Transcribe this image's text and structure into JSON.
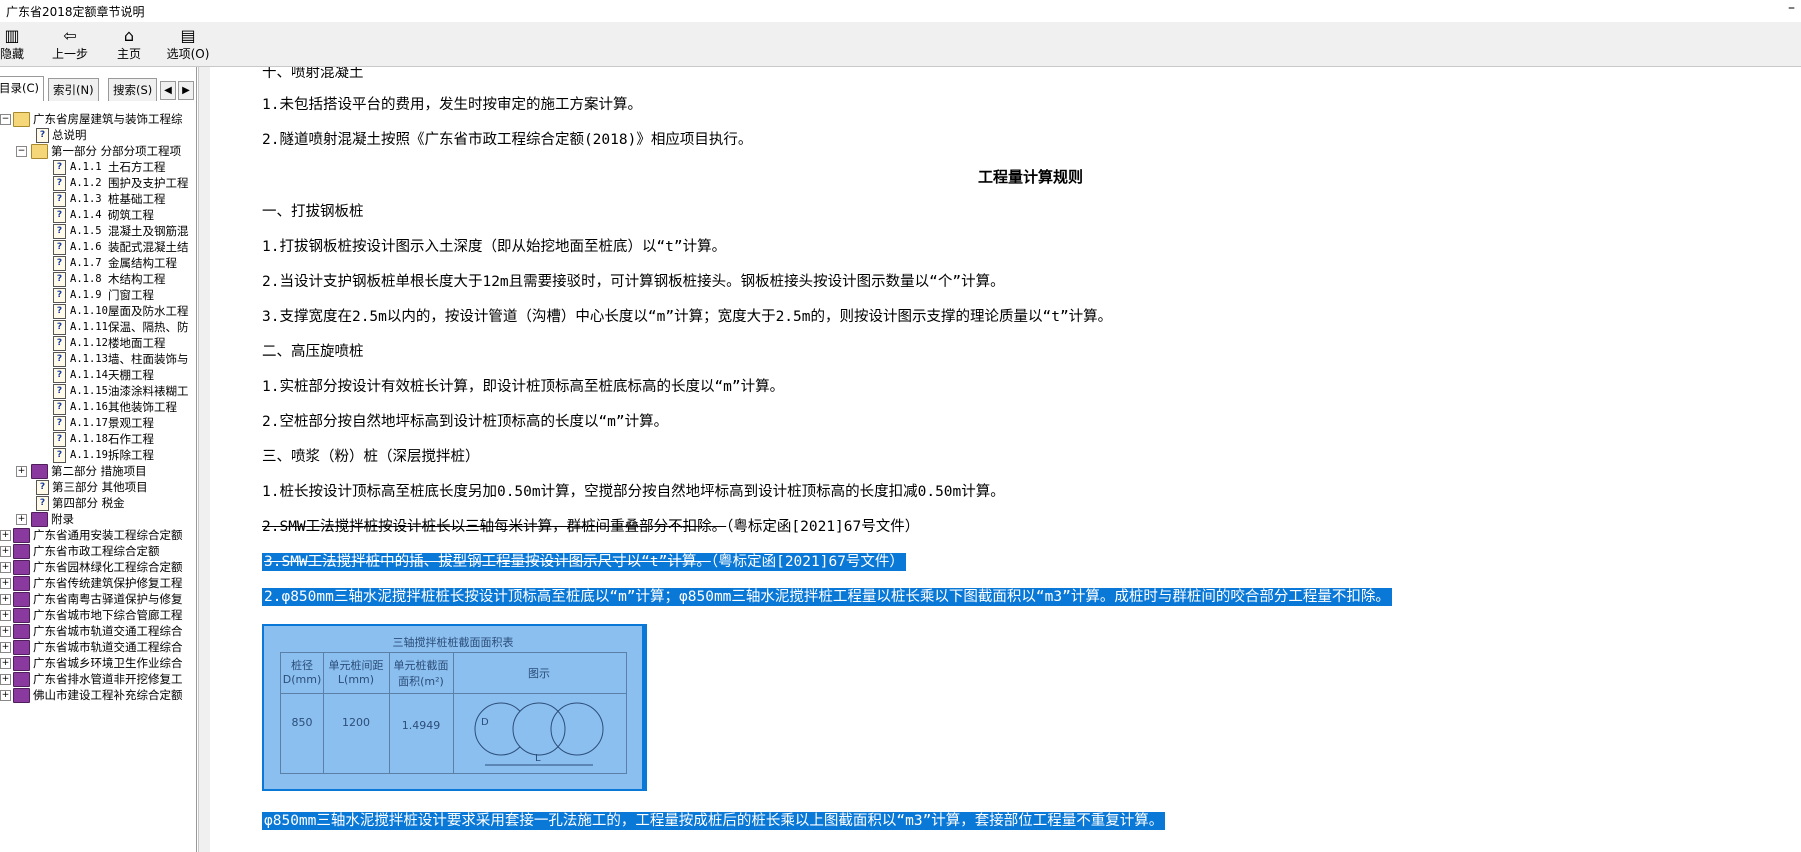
{
  "window": {
    "title": "广东省2018定额章节说明"
  },
  "toolbar": {
    "hide": "隐藏",
    "back": "上一步",
    "home": "主页",
    "options": "选项(O)"
  },
  "tabs": {
    "contents": "目录(C)",
    "index": "索引(N)",
    "search": "搜索(S)"
  },
  "tree": {
    "root": "广东省房屋建筑与装饰工程综",
    "general": "总说明",
    "part1": "第一部分 分部分项工程项",
    "chapters": [
      {
        "code": "A.1.1",
        "name": "土石方工程"
      },
      {
        "code": "A.1.2",
        "name": "围护及支护工程"
      },
      {
        "code": "A.1.3",
        "name": "桩基础工程"
      },
      {
        "code": "A.1.4",
        "name": "砌筑工程"
      },
      {
        "code": "A.1.5",
        "name": "混凝土及钢筋混"
      },
      {
        "code": "A.1.6",
        "name": "装配式混凝土结"
      },
      {
        "code": "A.1.7",
        "name": "金属结构工程"
      },
      {
        "code": "A.1.8",
        "name": "木结构工程"
      },
      {
        "code": "A.1.9",
        "name": "门窗工程"
      },
      {
        "code": "A.1.10",
        "name": "屋面及防水工程"
      },
      {
        "code": "A.1.11",
        "name": "保温、隔热、防"
      },
      {
        "code": "A.1.12",
        "name": "楼地面工程"
      },
      {
        "code": "A.1.13",
        "name": "墙、柱面装饰与"
      },
      {
        "code": "A.1.14",
        "name": "天棚工程"
      },
      {
        "code": "A.1.15",
        "name": "油漆涂料裱糊工"
      },
      {
        "code": "A.1.16",
        "name": "其他装饰工程"
      },
      {
        "code": "A.1.17",
        "name": "景观工程"
      },
      {
        "code": "A.1.18",
        "name": "石作工程"
      },
      {
        "code": "A.1.19",
        "name": "拆除工程"
      }
    ],
    "part2": "第二部分 措施项目",
    "part3": "第三部分 其他项目",
    "part4": "第四部分 税金",
    "appendix": "附录",
    "others": [
      "广东省通用安装工程综合定额",
      "广东省市政工程综合定额",
      "广东省园林绿化工程综合定额",
      "广东省传统建筑保护修复工程",
      "广东省南粤古驿道保护与修复",
      "广东省城市地下综合管廊工程",
      "广东省城市轨道交通工程综合",
      "广东省城市轨道交通工程综合",
      "广东省城乡环境卫生作业综合",
      "广东省排水管道非开挖修复工",
      "佛山市建设工程补充综合定额"
    ]
  },
  "content": {
    "section_top": "十、喷射混凝土",
    "lines": [
      "1.未包括搭设平台的费用，发生时按审定的施工方案计算。",
      "2.隧道喷射混凝土按照《广东省市政工程综合定额(2018)》相应项目执行。"
    ],
    "rules_heading": "工程量计算规则",
    "s1_title": "一、打拔钢板桩",
    "s1": [
      "1.打拔钢板桩按设计图示入土深度（即从始挖地面至桩底）以“t”计算。",
      "2.当设计支护钢板桩单根长度大于12m且需要接驳时，可计算钢板桩接头。钢板桩接头按设计图示数量以“个”计算。",
      "3.支撑宽度在2.5m以内的，按设计管道（沟槽）中心长度以“m”计算；宽度大于2.5m的，则按设计图示支撑的理论质量以“t”计算。"
    ],
    "s2_title": "二、高压旋喷桩",
    "s2": [
      "1.实桩部分按设计有效桩长计算，即设计桩顶标高至桩底标高的长度以“m”计算。",
      "2.空桩部分按自然地坪标高到设计桩顶标高的长度以“m”计算。"
    ],
    "s3_title": "三、喷浆（粉）桩（深层搅拌桩）",
    "s3_1": "1.桩长按设计顶标高至桩底长度另加0.50m计算，空搅部分按自然地坪标高到设计桩顶标高的长度扣减0.50m计算。",
    "s3_2_struck": "2.SMW工法搅拌桩按设计桩长以三轴每米计算，群桩间重叠部分不扣除。",
    "s3_2_note": "（粤标定函[2021]67号文件）",
    "s3_3_struck": "3.SMW工法搅拌桩中的插、拔型钢工程量按设计图示尺寸以“t”计算。",
    "s3_3_note": "（粤标定函[2021]67号文件）",
    "s3_new2": "2.φ850mm三轴水泥搅拌桩桩长按设计顶标高至桩底以“m”计算；φ850mm三轴水泥搅拌桩工程量以桩长乘以下图截面积以“m3”计算。成桩时与群桩间的咬合部分工程量不扣除。",
    "table": {
      "title": "三轴搅拌桩桩截面面积表",
      "h1": "桩径",
      "h1b": "D(mm)",
      "h2": "单元桩间距",
      "h2b": "L(mm)",
      "h3": "单元桩截面",
      "h3b": "面积(m²)",
      "h4": "图示",
      "v1": "850",
      "v2": "1200",
      "v3": "1.4949",
      "d_label": "D",
      "l_label": "L"
    },
    "last_line": "φ850mm三轴水泥搅拌桩设计要求采用套接一孔法施工的，工程量按成桩后的桩长乘以上图截面积以“m3”计算，套接部位工程量不重复计算。"
  }
}
